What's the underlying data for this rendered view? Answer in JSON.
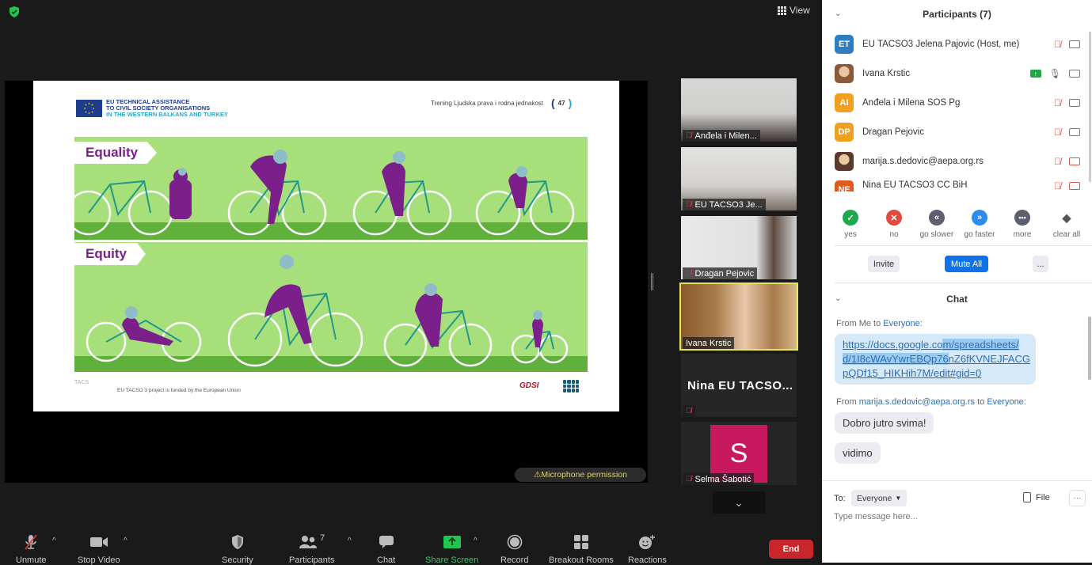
{
  "top": {
    "view_label": "View",
    "security_icon": "shield-check-icon"
  },
  "slide": {
    "org_line1": "EU TECHNICAL ASSISTANCE",
    "org_line2": "TO CIVIL SOCIETY ORGANISATIONS",
    "org_line3": "IN THE WESTERN BALKANS AND TURKEY",
    "title": "Trening Ljudska prava i rodna jednakost",
    "page_number": "47",
    "panel_top_label": "Equality",
    "panel_bottom_label": "Equity",
    "footer_text": "EU TACSO 3 project is funded by the European Union",
    "tacs_logo": "TACS",
    "gdsi_logo": "GDSI"
  },
  "mic_permission": "⚠Microphone permission",
  "gallery": {
    "tiles": [
      {
        "name": "Anđela i Milen...",
        "muted": true
      },
      {
        "name": "EU TACSO3 Je...",
        "muted": true
      },
      {
        "name": "Dragan Pejovic",
        "muted": true
      },
      {
        "name": "Ivana Krstic",
        "muted": false,
        "active": true
      },
      {
        "name": "Nina EU TACSO...",
        "muted": true
      },
      {
        "name": "Selma Šabotić",
        "muted": true,
        "avatar_letter": "S"
      }
    ]
  },
  "toolbar": {
    "unmute": "Unmute",
    "stop_video": "Stop Video",
    "security": "Security",
    "participants": "Participants",
    "participants_count": "7",
    "chat": "Chat",
    "share_screen": "Share Screen",
    "record": "Record",
    "breakout_rooms": "Breakout Rooms",
    "reactions": "Reactions",
    "end": "End"
  },
  "participants_panel": {
    "title": "Participants (7)",
    "list": [
      {
        "initials": "ET",
        "name": "EU TACSO3 Jelena Pajovic (Host, me)",
        "color": "#2e7dc1",
        "mic": "muted",
        "video": "on"
      },
      {
        "initials": "",
        "name": "Ivana Krstic",
        "color": "#8b5a3c",
        "mic": "on",
        "video": "on",
        "sharing": true
      },
      {
        "initials": "AI",
        "name": "Anđela i Milena SOS Pg",
        "color": "#f0a020",
        "mic": "muted",
        "video": "on"
      },
      {
        "initials": "DP",
        "name": "Dragan Pejovic",
        "color": "#f0a020",
        "mic": "muted",
        "video": "on"
      },
      {
        "initials": "",
        "name": "marija.s.dedovic@aepa.org.rs",
        "color": "#5a3a2c",
        "mic": "muted",
        "video": "off"
      },
      {
        "initials": "NE",
        "name": "Nina EU TACSO3 CC BiH",
        "color": "#e05a1a",
        "mic": "muted",
        "video": "off"
      }
    ],
    "feedback": [
      {
        "label": "yes",
        "color": "#1fa94f",
        "glyph": "✓"
      },
      {
        "label": "no",
        "color": "#e14b3f",
        "glyph": "✕"
      },
      {
        "label": "go slower",
        "color": "#5d5f6e",
        "glyph": "«"
      },
      {
        "label": "go faster",
        "color": "#2d8cf0",
        "glyph": "»"
      },
      {
        "label": "more",
        "color": "#5d5f6e",
        "glyph": "···"
      },
      {
        "label": "clear all",
        "color": "#555",
        "glyph": "◆"
      }
    ],
    "invite": "Invite",
    "mute_all": "Mute All",
    "more": "..."
  },
  "chat": {
    "title": "Chat",
    "messages": [
      {
        "from_prefix": "From Me to ",
        "to": "Everyone",
        "suffix": ":",
        "link_line1_a": "https://docs.google.co",
        "link_line1_b": "m/spreadsheets/",
        "link_line2_a": "d/1I8cWAvYwrEBQp76",
        "link_line2_b": "nZ6fKVNEJFACG",
        "link_line3": "pQDf15_HIKHih7M/edit#gid=0"
      },
      {
        "from_prefix": "From ",
        "sender": "marija.s.dedovic@aepa.org.rs",
        "mid": " to ",
        "to": "Everyone",
        "suffix": ":",
        "text1": "Dobro jutro svima!",
        "text2": "vidimo"
      }
    ],
    "to_label": "To:",
    "to_value": "Everyone",
    "file_label": "File",
    "more": "···",
    "placeholder": "Type message here..."
  }
}
